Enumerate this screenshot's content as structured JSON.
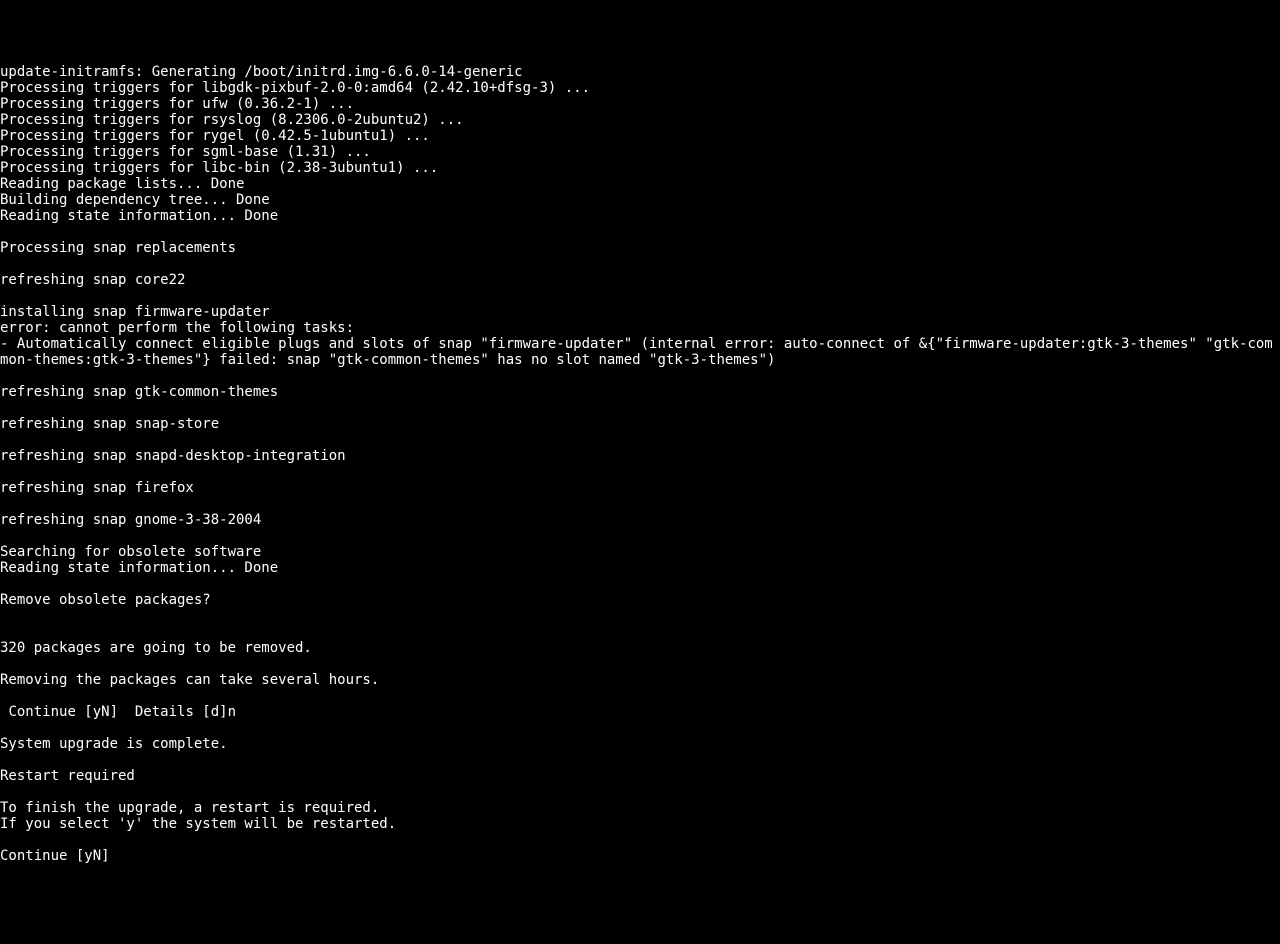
{
  "terminal": {
    "lines": [
      "update-initramfs: Generating /boot/initrd.img-6.6.0-14-generic",
      "Processing triggers for libgdk-pixbuf-2.0-0:amd64 (2.42.10+dfsg-3) ...",
      "Processing triggers for ufw (0.36.2-1) ...",
      "Processing triggers for rsyslog (8.2306.0-2ubuntu2) ...",
      "Processing triggers for rygel (0.42.5-1ubuntu1) ...",
      "Processing triggers for sgml-base (1.31) ...",
      "Processing triggers for libc-bin (2.38-3ubuntu1) ...",
      "Reading package lists... Done",
      "Building dependency tree... Done",
      "Reading state information... Done",
      "",
      "Processing snap replacements",
      "",
      "refreshing snap core22",
      "",
      "installing snap firmware-updater",
      "error: cannot perform the following tasks:",
      "- Automatically connect eligible plugs and slots of snap \"firmware-updater\" (internal error: auto-connect of &{\"firmware-updater:gtk-3-themes\" \"gtk-common-themes:gtk-3-themes\"} failed: snap \"gtk-common-themes\" has no slot named \"gtk-3-themes\")",
      "",
      "refreshing snap gtk-common-themes",
      "",
      "refreshing snap snap-store",
      "",
      "refreshing snap snapd-desktop-integration",
      "",
      "refreshing snap firefox",
      "",
      "refreshing snap gnome-3-38-2004",
      "",
      "Searching for obsolete software",
      "Reading state information... Done",
      "",
      "Remove obsolete packages?",
      "",
      "",
      "320 packages are going to be removed.",
      "",
      "Removing the packages can take several hours.",
      "",
      " Continue [yN]  Details [d]n",
      "",
      "System upgrade is complete.",
      "",
      "Restart required",
      "",
      "To finish the upgrade, a restart is required.",
      "If you select 'y' the system will be restarted.",
      "",
      "Continue [yN]"
    ]
  }
}
